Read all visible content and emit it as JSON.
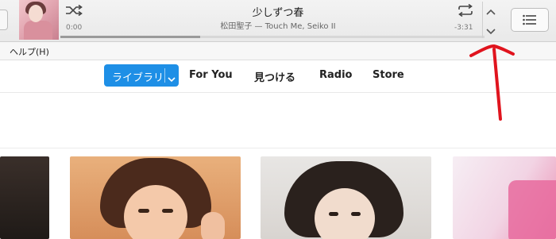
{
  "player": {
    "track_title": "少しずつ春",
    "track_subtitle": "松田聖子 — Touch Me, Seiko II",
    "elapsed": "0:00",
    "remaining": "-3:31",
    "progress": 0.33
  },
  "menu": {
    "help": "ヘルプ(H)"
  },
  "nav": {
    "library": "ライブラリ",
    "for_you": "For You",
    "browse": "見つける",
    "radio": "Radio",
    "store": "Store"
  },
  "colors": {
    "accent": "#1e8fe6",
    "annotation": "#e0141e"
  },
  "icons": [
    "shuffle-icon",
    "repeat-icon",
    "chevron-up-icon",
    "chevron-down-icon",
    "list-icon",
    "dropdown-chevron-icon"
  ]
}
